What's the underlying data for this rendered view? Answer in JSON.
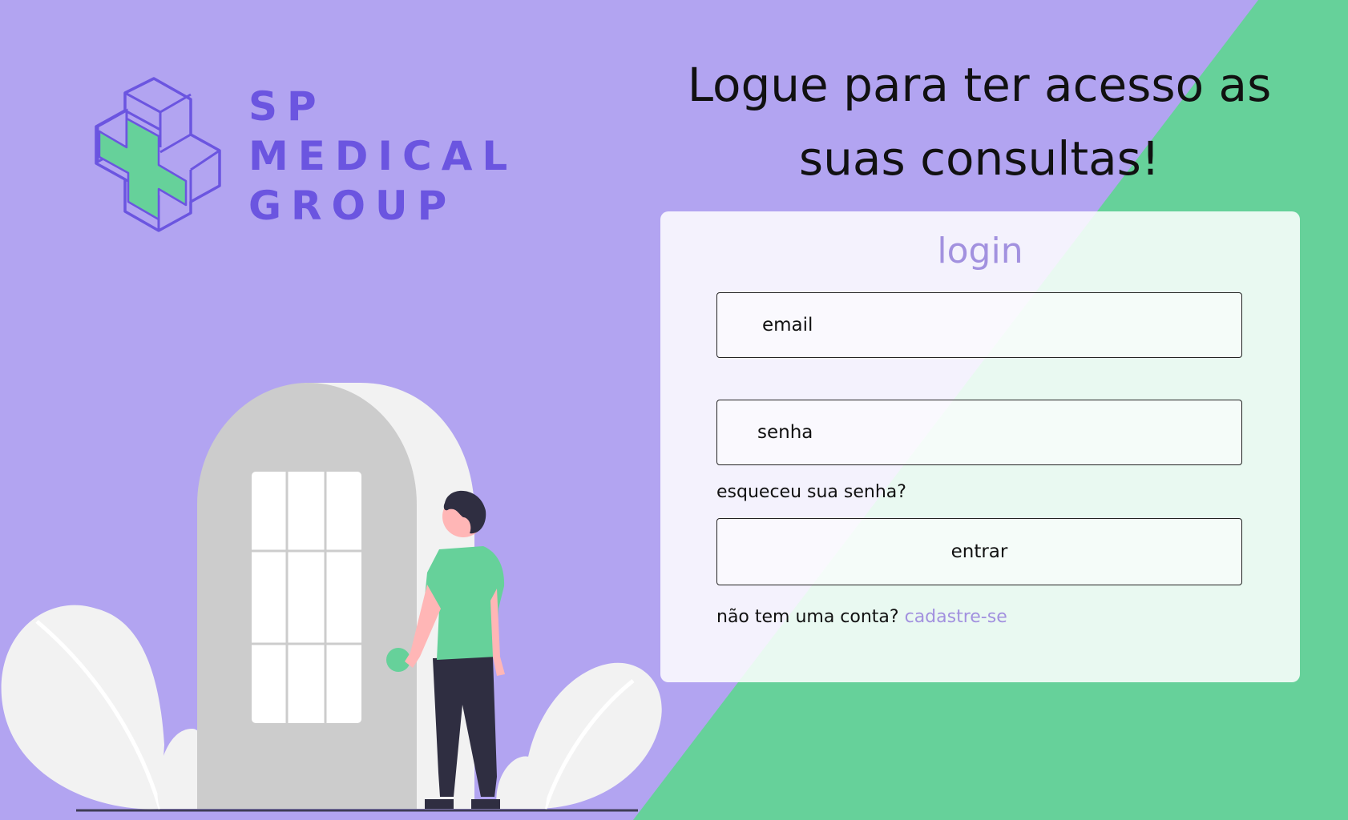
{
  "colors": {
    "background_purple": "#b2a4f1",
    "accent_green": "#66d19a",
    "brand_purple": "#6b55e0",
    "link_lavender": "#a291df"
  },
  "brand": {
    "logo_icon": "medical-cross-cube-icon",
    "line1": "SP",
    "line2": "MEDICAL",
    "line3": "GROUP"
  },
  "headline": "Logue para ter acesso as suas consultas!",
  "login": {
    "title": "login",
    "email_placeholder": "email",
    "password_placeholder": "senha",
    "forgot_password": "esqueceu sua senha?",
    "submit_label": "entrar",
    "no_account_text": "não tem uma conta?",
    "signup_link": "cadastre-se"
  }
}
